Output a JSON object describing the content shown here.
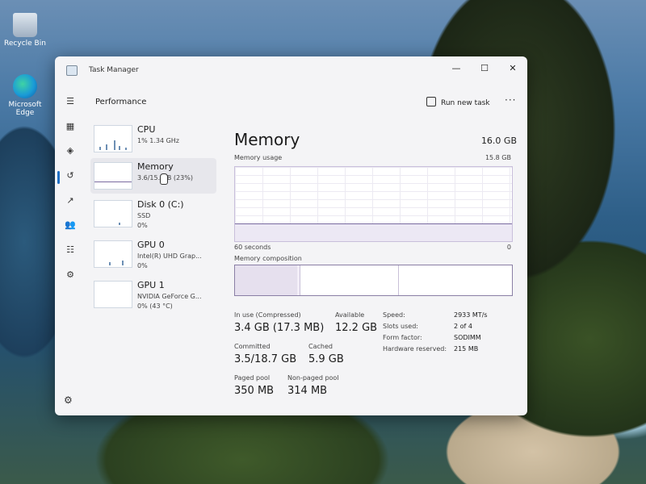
{
  "desktop": {
    "recycle_bin": "Recycle Bin",
    "edge": "Microsoft Edge"
  },
  "window": {
    "title": "Task Manager",
    "minimize": "—",
    "maximize": "☐",
    "close": "✕"
  },
  "header": {
    "title": "Performance",
    "run_task": "Run new task",
    "more": "···"
  },
  "sidebar_icons": {
    "menu": "☰",
    "processes": "▦",
    "performance": "◈",
    "history": "↺",
    "startup": "↗",
    "users": "👥",
    "details": "☷",
    "services": "⚙",
    "settings": "⚙"
  },
  "resources": [
    {
      "name": "CPU",
      "sub1": "1% 1.34 GHz",
      "sub2": ""
    },
    {
      "name": "Memory",
      "sub1": "3.6/15.  GB (23%)",
      "sub2": ""
    },
    {
      "name": "Disk 0 (C:)",
      "sub1": "SSD",
      "sub2": "0%"
    },
    {
      "name": "GPU 0",
      "sub1": "Intel(R) UHD Grap...",
      "sub2": "0%"
    },
    {
      "name": "GPU 1",
      "sub1": "NVIDIA GeForce G...",
      "sub2": "0% (43 °C)"
    }
  ],
  "memory": {
    "title": "Memory",
    "capacity": "16.0 GB",
    "usage_label": "Memory usage",
    "usage_max": "15.8 GB",
    "time_left": "60 seconds",
    "time_right": "0",
    "composition_label": "Memory composition",
    "usage_fraction": 0.23,
    "stats": {
      "in_use_label": "In use (Compressed)",
      "in_use_value": "3.4 GB (17.3 MB)",
      "available_label": "Available",
      "available_value": "12.2 GB",
      "committed_label": "Committed",
      "committed_value": "3.5/18.7 GB",
      "cached_label": "Cached",
      "cached_value": "5.9 GB",
      "paged_label": "Paged pool",
      "paged_value": "350 MB",
      "nonpaged_label": "Non-paged pool",
      "nonpaged_value": "314 MB"
    },
    "specs": [
      {
        "label": "Speed:",
        "value": "2933 MT/s"
      },
      {
        "label": "Slots used:",
        "value": "2 of 4"
      },
      {
        "label": "Form factor:",
        "value": "SODIMM"
      },
      {
        "label": "Hardware reserved:",
        "value": "215 MB"
      }
    ]
  },
  "colors": {
    "memory_accent": "#7a6ba0",
    "cpu_accent": "#6d8fb4",
    "active_nav": "#1f6fc4"
  }
}
